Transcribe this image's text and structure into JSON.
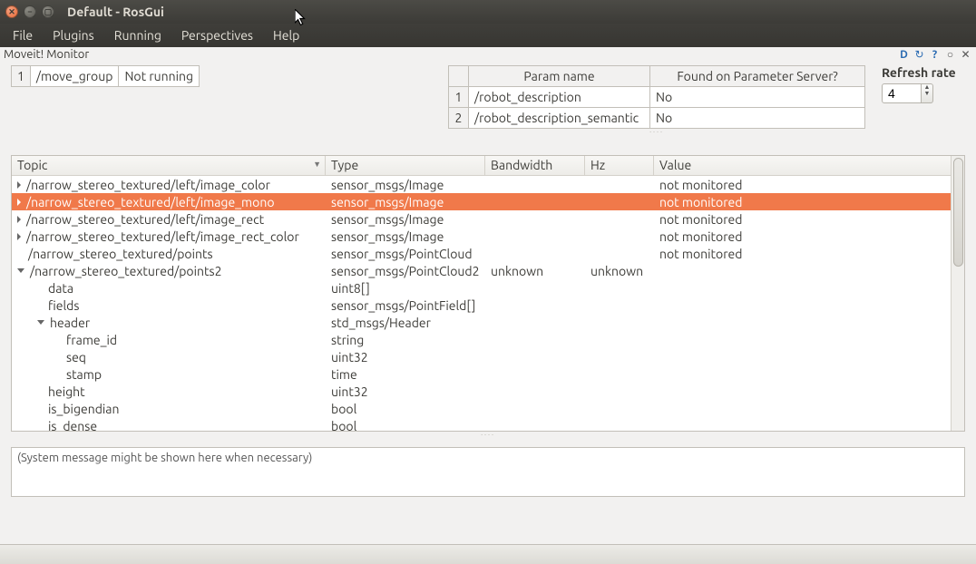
{
  "window": {
    "title": "Default - RosGui"
  },
  "menu": {
    "file": "File",
    "plugins": "Plugins",
    "running": "Running",
    "perspectives": "Perspectives",
    "help": "Help"
  },
  "dock": {
    "title": "Moveit! Monitor"
  },
  "nodes": {
    "rows": [
      {
        "idx": "1",
        "name": "/move_group",
        "status": "Not running"
      }
    ]
  },
  "params": {
    "header": {
      "name": "Param name",
      "found": "Found on Parameter Server?"
    },
    "rows": [
      {
        "idx": "1",
        "name": "/robot_description",
        "found": "No"
      },
      {
        "idx": "2",
        "name": "/robot_description_semantic",
        "found": "No"
      }
    ]
  },
  "refresh": {
    "label": "Refresh rate",
    "value": "4"
  },
  "topics": {
    "headers": {
      "topic": "Topic",
      "type": "Type",
      "bw": "Bandwidth",
      "hz": "Hz",
      "value": "Value"
    },
    "rows": [
      {
        "indent": 0,
        "exp": "closed",
        "topic": "/narrow_stereo_textured/left/image_color",
        "type": "sensor_msgs/Image",
        "bw": "",
        "hz": "",
        "value": "not monitored"
      },
      {
        "indent": 0,
        "exp": "closed",
        "selected": true,
        "topic": "/narrow_stereo_textured/left/image_mono",
        "type": "sensor_msgs/Image",
        "bw": "",
        "hz": "",
        "value": "not monitored"
      },
      {
        "indent": 0,
        "exp": "closed",
        "topic": "/narrow_stereo_textured/left/image_rect",
        "type": "sensor_msgs/Image",
        "bw": "",
        "hz": "",
        "value": "not monitored"
      },
      {
        "indent": 0,
        "exp": "closed",
        "topic": "/narrow_stereo_textured/left/image_rect_color",
        "type": "sensor_msgs/Image",
        "bw": "",
        "hz": "",
        "value": "not monitored"
      },
      {
        "indent": 0,
        "exp": "none",
        "topic": "/narrow_stereo_textured/points",
        "type": "sensor_msgs/PointCloud",
        "bw": "",
        "hz": "",
        "value": "not monitored"
      },
      {
        "indent": 0,
        "exp": "open",
        "topic": "/narrow_stereo_textured/points2",
        "type": "sensor_msgs/PointCloud2",
        "bw": "unknown",
        "hz": "unknown",
        "value": ""
      },
      {
        "indent": 1,
        "exp": "none",
        "topic": "data",
        "type": "uint8[]",
        "bw": "",
        "hz": "",
        "value": ""
      },
      {
        "indent": 1,
        "exp": "none",
        "topic": "fields",
        "type": "sensor_msgs/PointField[]",
        "bw": "",
        "hz": "",
        "value": ""
      },
      {
        "indent": 1,
        "exp": "open",
        "topic": "header",
        "type": "std_msgs/Header",
        "bw": "",
        "hz": "",
        "value": ""
      },
      {
        "indent": 2,
        "exp": "none",
        "topic": "frame_id",
        "type": "string",
        "bw": "",
        "hz": "",
        "value": ""
      },
      {
        "indent": 2,
        "exp": "none",
        "topic": "seq",
        "type": "uint32",
        "bw": "",
        "hz": "",
        "value": ""
      },
      {
        "indent": 2,
        "exp": "none",
        "topic": "stamp",
        "type": "time",
        "bw": "",
        "hz": "",
        "value": ""
      },
      {
        "indent": 1,
        "exp": "none",
        "topic": "height",
        "type": "uint32",
        "bw": "",
        "hz": "",
        "value": ""
      },
      {
        "indent": 1,
        "exp": "none",
        "topic": "is_bigendian",
        "type": "bool",
        "bw": "",
        "hz": "",
        "value": ""
      },
      {
        "indent": 1,
        "exp": "none",
        "topic": "is_dense",
        "type": "bool",
        "bw": "",
        "hz": "",
        "value": ""
      }
    ]
  },
  "sysmsg": "(System message might be shown here when necessary)"
}
